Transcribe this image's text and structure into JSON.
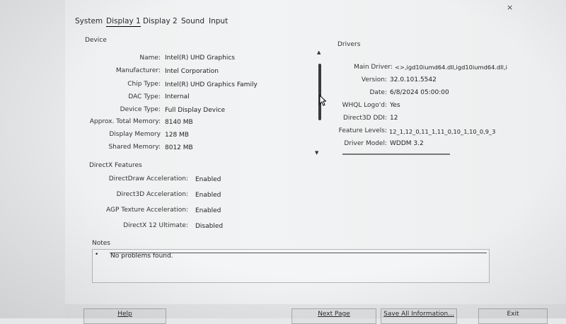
{
  "tabs": [
    "System",
    "Display 1",
    "Display 2",
    "Sound",
    "Input"
  ],
  "close_label": "×",
  "device": {
    "title": "Device",
    "rows": [
      {
        "label": "Name:",
        "value": "Intel(R) UHD Graphics"
      },
      {
        "label": "Manufacturer:",
        "value": "Intel Corporation"
      },
      {
        "label": "Chip Type:",
        "value": "Intel(R) UHD Graphics Family"
      },
      {
        "label": "DAC Type:",
        "value": "Internal"
      },
      {
        "label": "Device Type:",
        "value": "Full Display Device"
      },
      {
        "label": "Approx. Total Memory:",
        "value": "8140 MB"
      },
      {
        "label": "Display Memory",
        "value": "128 MB"
      },
      {
        "label": "Shared Memory:",
        "value": "8012 MB"
      }
    ]
  },
  "drivers": {
    "title": "Drivers",
    "rows": [
      {
        "label": "Main Driver:",
        "value": "<>,igd10iumd64.dll,igd10iumd64.dll,i"
      },
      {
        "label": "Version:",
        "value": "32.0.101.5542"
      },
      {
        "label": "Date:",
        "value": "6/8/2024 05:00:00"
      },
      {
        "label": "WHQL Logo'd:",
        "value": "Yes"
      },
      {
        "label": "Direct3D DDI:",
        "value": "12"
      },
      {
        "label": "Feature Levels:",
        "value": "12_1,12_0,11_1,11_0,10_1,10_0,9_3"
      },
      {
        "label": "Driver Model:",
        "value": "WDDM 3.2"
      }
    ]
  },
  "directx": {
    "title": "DirectX Features",
    "rows": [
      {
        "label": "DirectDraw Acceleration:",
        "value": "Enabled"
      },
      {
        "label": "Direct3D Acceleration:",
        "value": "Enabled"
      },
      {
        "label": "AGP Texture Acceleration:",
        "value": "Enabled"
      },
      {
        "label": "DirectX 12 Ultimate:",
        "value": "Disabled"
      }
    ]
  },
  "notes": {
    "title": "Notes",
    "bullet": "•",
    "text": "No problems found."
  },
  "buttons": {
    "help": "Help",
    "next": "Next Page",
    "save": "Save All Information...",
    "exit": "Exit"
  },
  "icons": {
    "scroll_up": "triangle-up-icon",
    "scroll_down": "triangle-down-icon",
    "cursor": "mouse-pointer-icon"
  }
}
